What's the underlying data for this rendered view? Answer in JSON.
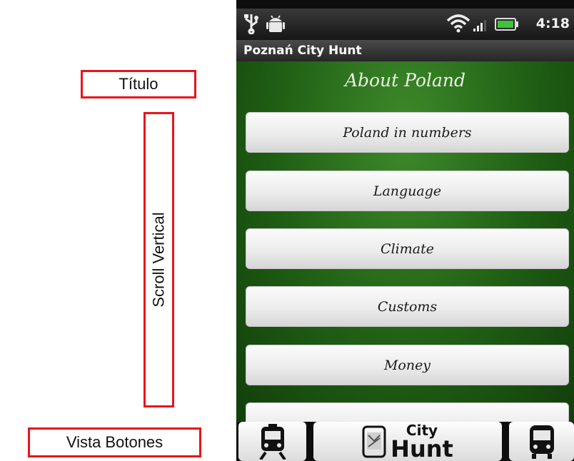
{
  "annotations": {
    "title": "Título",
    "scroll": "Scroll Vertical",
    "buttons": "Vista Botones"
  },
  "status_bar": {
    "time": "4:18",
    "icons": [
      "usb-icon",
      "android-debug-icon",
      "wifi-icon",
      "signal-icon",
      "battery-icon"
    ]
  },
  "app_title": "Poznań City Hunt",
  "screen_heading": "About Poland",
  "menu": [
    {
      "label": "Poland in numbers"
    },
    {
      "label": "Language"
    },
    {
      "label": "Climate"
    },
    {
      "label": "Customs"
    },
    {
      "label": "Money"
    }
  ],
  "bottom_bar": {
    "left_icon": "train-icon",
    "center_logo_line1": "City",
    "center_logo_line2": "Hunt",
    "right_icon": "bus-icon"
  },
  "colors": {
    "annotation_border": "#e8141b",
    "content_green": "#2f7a1f"
  }
}
